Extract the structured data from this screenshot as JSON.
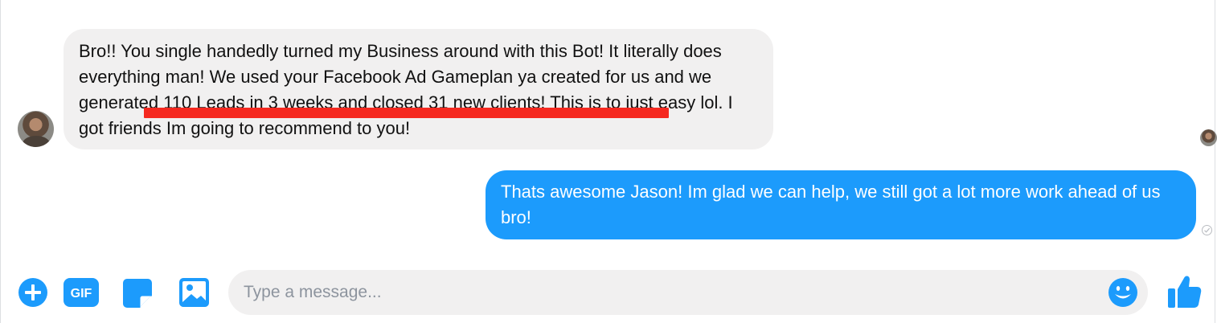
{
  "conversation": {
    "incoming": {
      "text": "Bro!! You single handedly turned my Business around with this Bot! It literally does everything man! We used your Facebook Ad Gameplan ya created for us and we generated 110 Leads in 3 weeks and closed 31 new clients! This is to just easy lol. I got friends Im going to recommend to you!",
      "highlight": "generated 110 Leads in 3 weeks and closed 31 new clients!"
    },
    "outgoing": {
      "text": "Thats awesome Jason! Im glad we can help, we still got a lot more work ahead of us bro!"
    }
  },
  "composer": {
    "placeholder": "Type a message...",
    "gif_label": "GIF",
    "icons": [
      "plus-icon",
      "gif-icon",
      "sticker-icon",
      "image-icon",
      "emoji-icon",
      "thumbs-up-icon"
    ]
  },
  "colors": {
    "accent": "#1c9bfc",
    "incoming_bubble": "#f1f0f0",
    "outgoing_bubble": "#1c9bfc",
    "highlight_underline": "#f5281f"
  }
}
